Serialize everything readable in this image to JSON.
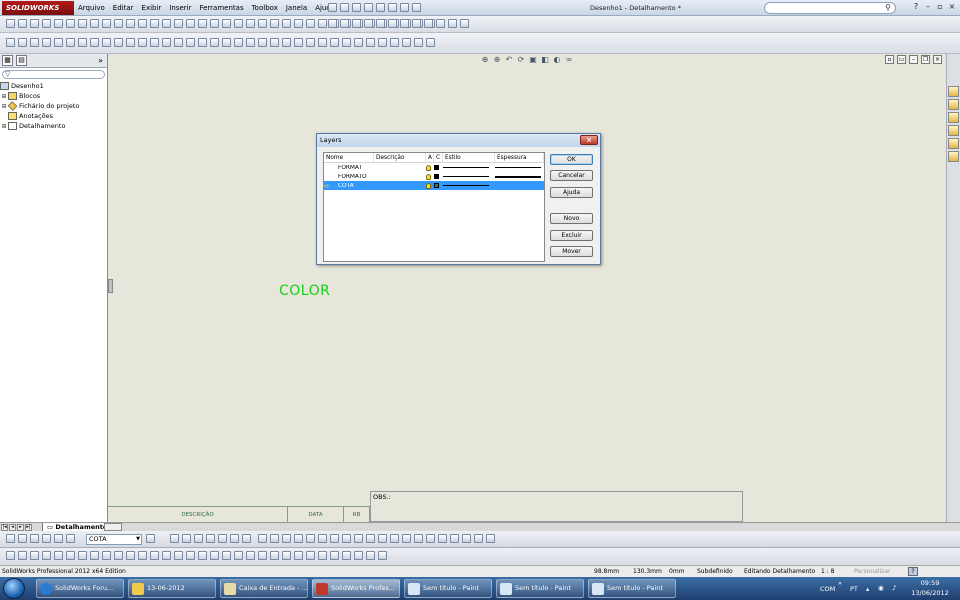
{
  "app": {
    "logo": "SOLIDWORKS",
    "window_title": "Desenho1 - Detalhamento *",
    "menu": [
      "Arquivo",
      "Editar",
      "Exibir",
      "Inserir",
      "Ferramentas",
      "Toolbox",
      "Janela",
      "Ajuda"
    ],
    "search_placeholder": ""
  },
  "feature_tree": {
    "root": "Desenho1",
    "items": [
      {
        "label": "Blocos",
        "icon": "blocks-folder-icon"
      },
      {
        "label": "Fichário do projeto",
        "icon": "design-binder-icon"
      },
      {
        "label": "Anotações",
        "icon": "annotations-icon"
      },
      {
        "label": "Detalhamento",
        "icon": "sheet-icon"
      }
    ]
  },
  "graphics": {
    "color_text": "COLOR",
    "text_color": "#14d214",
    "sheet_table": {
      "col1": "DESCRIÇÃO",
      "col2": "DATA",
      "col3": "RB"
    },
    "obs_label": "OBS.:"
  },
  "sheet_tabs": {
    "active": "Detalhamento"
  },
  "layer_toolbar": {
    "selected_layer": "COTA"
  },
  "status_bar": {
    "edition": "SolidWorks Professional 2012 x64 Edition",
    "x": "98.8mm",
    "y": "130.3mm",
    "z": "0mm",
    "state": "Subdefinido",
    "editing": "Editando Detalhamento",
    "scale": "1 : 8",
    "custom": "Personalizar",
    "help": "?"
  },
  "taskbar": {
    "tasks": [
      {
        "label": "SolidWorks Foru...",
        "icon": "ie-icon",
        "active": false
      },
      {
        "label": "13-06-2012",
        "icon": "folder-icon",
        "active": false
      },
      {
        "label": "Caixa de Entrada - ...",
        "icon": "outlook-icon",
        "active": false
      },
      {
        "label": "SolidWorks Profes...",
        "icon": "solidworks-icon",
        "active": true
      },
      {
        "label": "Sem título - Paint",
        "icon": "paint-icon",
        "active": false
      },
      {
        "label": "Sem título - Paint",
        "icon": "paint-icon",
        "active": false
      },
      {
        "label": "Sem título - Paint",
        "icon": "paint-icon",
        "active": false
      }
    ],
    "tray": {
      "com": "COM",
      "lang": "PT",
      "time": "09:59",
      "date": "13/06/2012"
    }
  },
  "layers_dialog": {
    "title": "Layers",
    "columns": [
      "Nome",
      "Descrição",
      "A",
      "C",
      "Estilo",
      "Espessura"
    ],
    "rows": [
      {
        "name": "FORMAT",
        "color": "#000000",
        "selected": false,
        "current": false
      },
      {
        "name": "FORMATO",
        "color": "#000000",
        "selected": false,
        "current": false
      },
      {
        "name": "COTA",
        "color": "#1a8c5a",
        "selected": true,
        "current": true
      }
    ],
    "buttons": {
      "ok": "OK",
      "cancel": "Cancelar",
      "help": "Ajuda",
      "new": "Novo",
      "delete": "Excluir",
      "move": "Mover"
    }
  }
}
